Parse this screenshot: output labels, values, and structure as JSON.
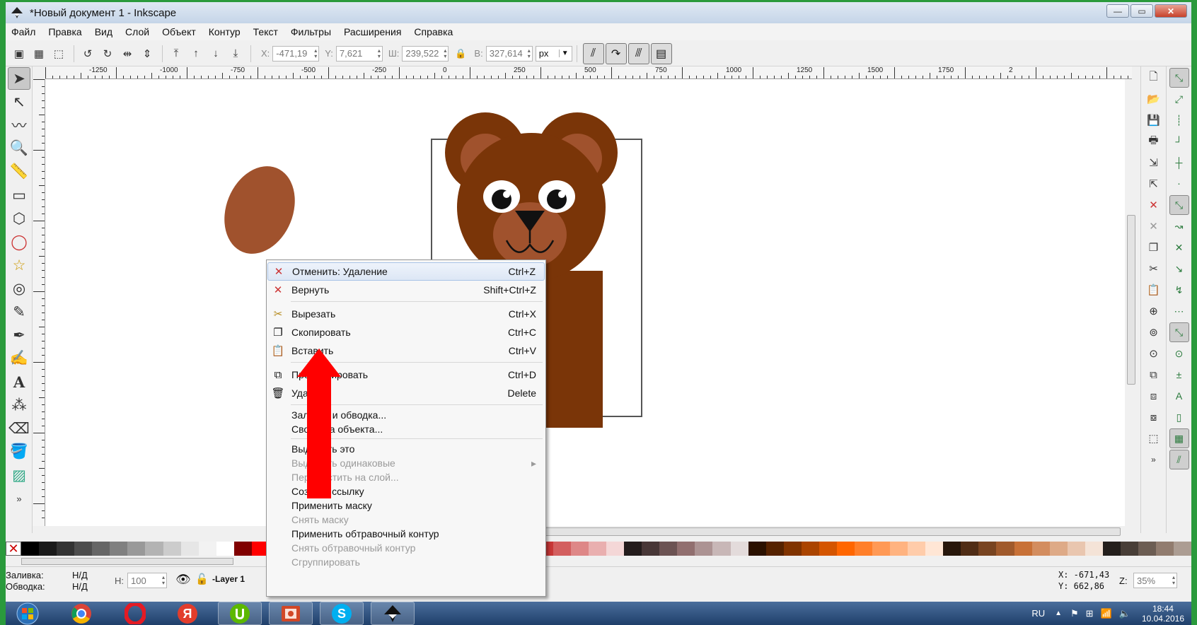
{
  "window": {
    "title": "*Новый документ 1 - Inkscape",
    "min_label": "—",
    "max_label": "▭",
    "close_label": "✕"
  },
  "menubar": [
    "Файл",
    "Правка",
    "Вид",
    "Слой",
    "Объект",
    "Контур",
    "Текст",
    "Фильтры",
    "Расширения",
    "Справка"
  ],
  "toolbar": {
    "x_label": "X:",
    "x_value": "-471,19",
    "y_label": "Y:",
    "y_value": "7,621",
    "w_label": "Ш:",
    "w_value": "239,522",
    "h_label": "В:",
    "h_value": "327,614",
    "unit": "px"
  },
  "ruler_labels": [
    "-1250",
    "-1000",
    "-750",
    "-500",
    "-250",
    "0",
    "250",
    "500",
    "750",
    "1000",
    "1250",
    "1500",
    "1750",
    "2"
  ],
  "context_menu": [
    {
      "label": "Отменить: Удаление",
      "shortcut": "Ctrl+Z",
      "icon": "undo-icon",
      "glyph": "✕",
      "enabled": true,
      "highlight": true
    },
    {
      "label": "Вернуть",
      "shortcut": "Shift+Ctrl+Z",
      "icon": "redo-icon",
      "glyph": "✕",
      "enabled": true
    },
    {
      "sep": true
    },
    {
      "label": "Вырезать",
      "shortcut": "Ctrl+X",
      "icon": "scissors-icon",
      "glyph": "✂",
      "enabled": true
    },
    {
      "label": "Скопировать",
      "shortcut": "Ctrl+C",
      "icon": "copy-icon",
      "glyph": "❐",
      "enabled": true
    },
    {
      "label": "Вставить",
      "shortcut": "Ctrl+V",
      "icon": "paste-icon",
      "glyph": "📋",
      "enabled": true
    },
    {
      "sep": true
    },
    {
      "label": "Продублировать",
      "shortcut": "Ctrl+D",
      "icon": "duplicate-icon",
      "glyph": "⧉",
      "enabled": true
    },
    {
      "label": "Удалить",
      "shortcut": "Delete",
      "icon": "trash-icon",
      "glyph": "🗑",
      "enabled": true
    },
    {
      "sep": true
    },
    {
      "label": "Заливка и обводка...",
      "shortcut": "",
      "enabled": true
    },
    {
      "label": "Свойства объекта...",
      "shortcut": "",
      "enabled": true
    },
    {
      "sep": true
    },
    {
      "label": "Выделить это",
      "shortcut": "",
      "enabled": true
    },
    {
      "label": "Выделить одинаковые",
      "shortcut": "",
      "enabled": false,
      "submenu": true
    },
    {
      "label": "Переместить на слой...",
      "shortcut": "",
      "enabled": false
    },
    {
      "label": "Создать ссылку",
      "shortcut": "",
      "enabled": true
    },
    {
      "label": "Применить маску",
      "shortcut": "",
      "enabled": true
    },
    {
      "label": "Снять маску",
      "shortcut": "",
      "enabled": false
    },
    {
      "label": "Применить обтравочный контур",
      "shortcut": "",
      "enabled": true
    },
    {
      "label": "Снять обтравочный контур",
      "shortcut": "",
      "enabled": false
    },
    {
      "label": "Сгруппировать",
      "shortcut": "",
      "enabled": false
    }
  ],
  "status": {
    "fill_label": "Заливка:",
    "fill_value": "Н/Д",
    "stroke_label": "Обводка:",
    "stroke_value": "Н/Д",
    "opacity_label": "Н:",
    "opacity_value": "100",
    "layer": "-Layer 1",
    "x_readout": "X: -671,43",
    "y_readout": "Y:  662,86",
    "zoom_label": "Z:",
    "zoom_value": "35%"
  },
  "palette": [
    "#000000",
    "#1a1a1a",
    "#333333",
    "#4d4d4d",
    "#666666",
    "#808080",
    "#999999",
    "#b3b3b3",
    "#cccccc",
    "#e6e6e6",
    "#f2f2f2",
    "#ffffff",
    "#800000",
    "#ff0000",
    "#ffcccc",
    "#2b0000",
    "#550000",
    "#800000",
    "#aa0000",
    "#d40000",
    "#ff2a2a",
    "#ff5555",
    "#ff8080",
    "#ffaaaa",
    "#ffd5d5",
    "#280b0b",
    "#501616",
    "#782121",
    "#a02c2c",
    "#c83737",
    "#d35f5f",
    "#de8787",
    "#e9afaf",
    "#f4d7d7",
    "#241c1c",
    "#483737",
    "#6c5353",
    "#916f6f",
    "#ac9393",
    "#c8b7b7",
    "#e3dbdb",
    "#2b1100",
    "#552200",
    "#803300",
    "#aa4400",
    "#d45500",
    "#ff6600",
    "#ff7f2a",
    "#ff9955",
    "#ffb380",
    "#ffccaa",
    "#ffe6d5",
    "#28170b",
    "#502d16",
    "#784421",
    "#a05a2c",
    "#c87137",
    "#d38d5f",
    "#deaa87",
    "#e9c6af",
    "#f4e3d7",
    "#241f1c",
    "#483e37",
    "#6c5d53",
    "#917c6f",
    "#ac9d93"
  ],
  "taskbar": {
    "apps": [
      "start-button",
      "chrome",
      "opera",
      "yandex",
      "utorrent",
      "presentation",
      "skype",
      "inkscape"
    ],
    "lang": "RU",
    "time": "18:44",
    "date": "10.04.2016"
  }
}
